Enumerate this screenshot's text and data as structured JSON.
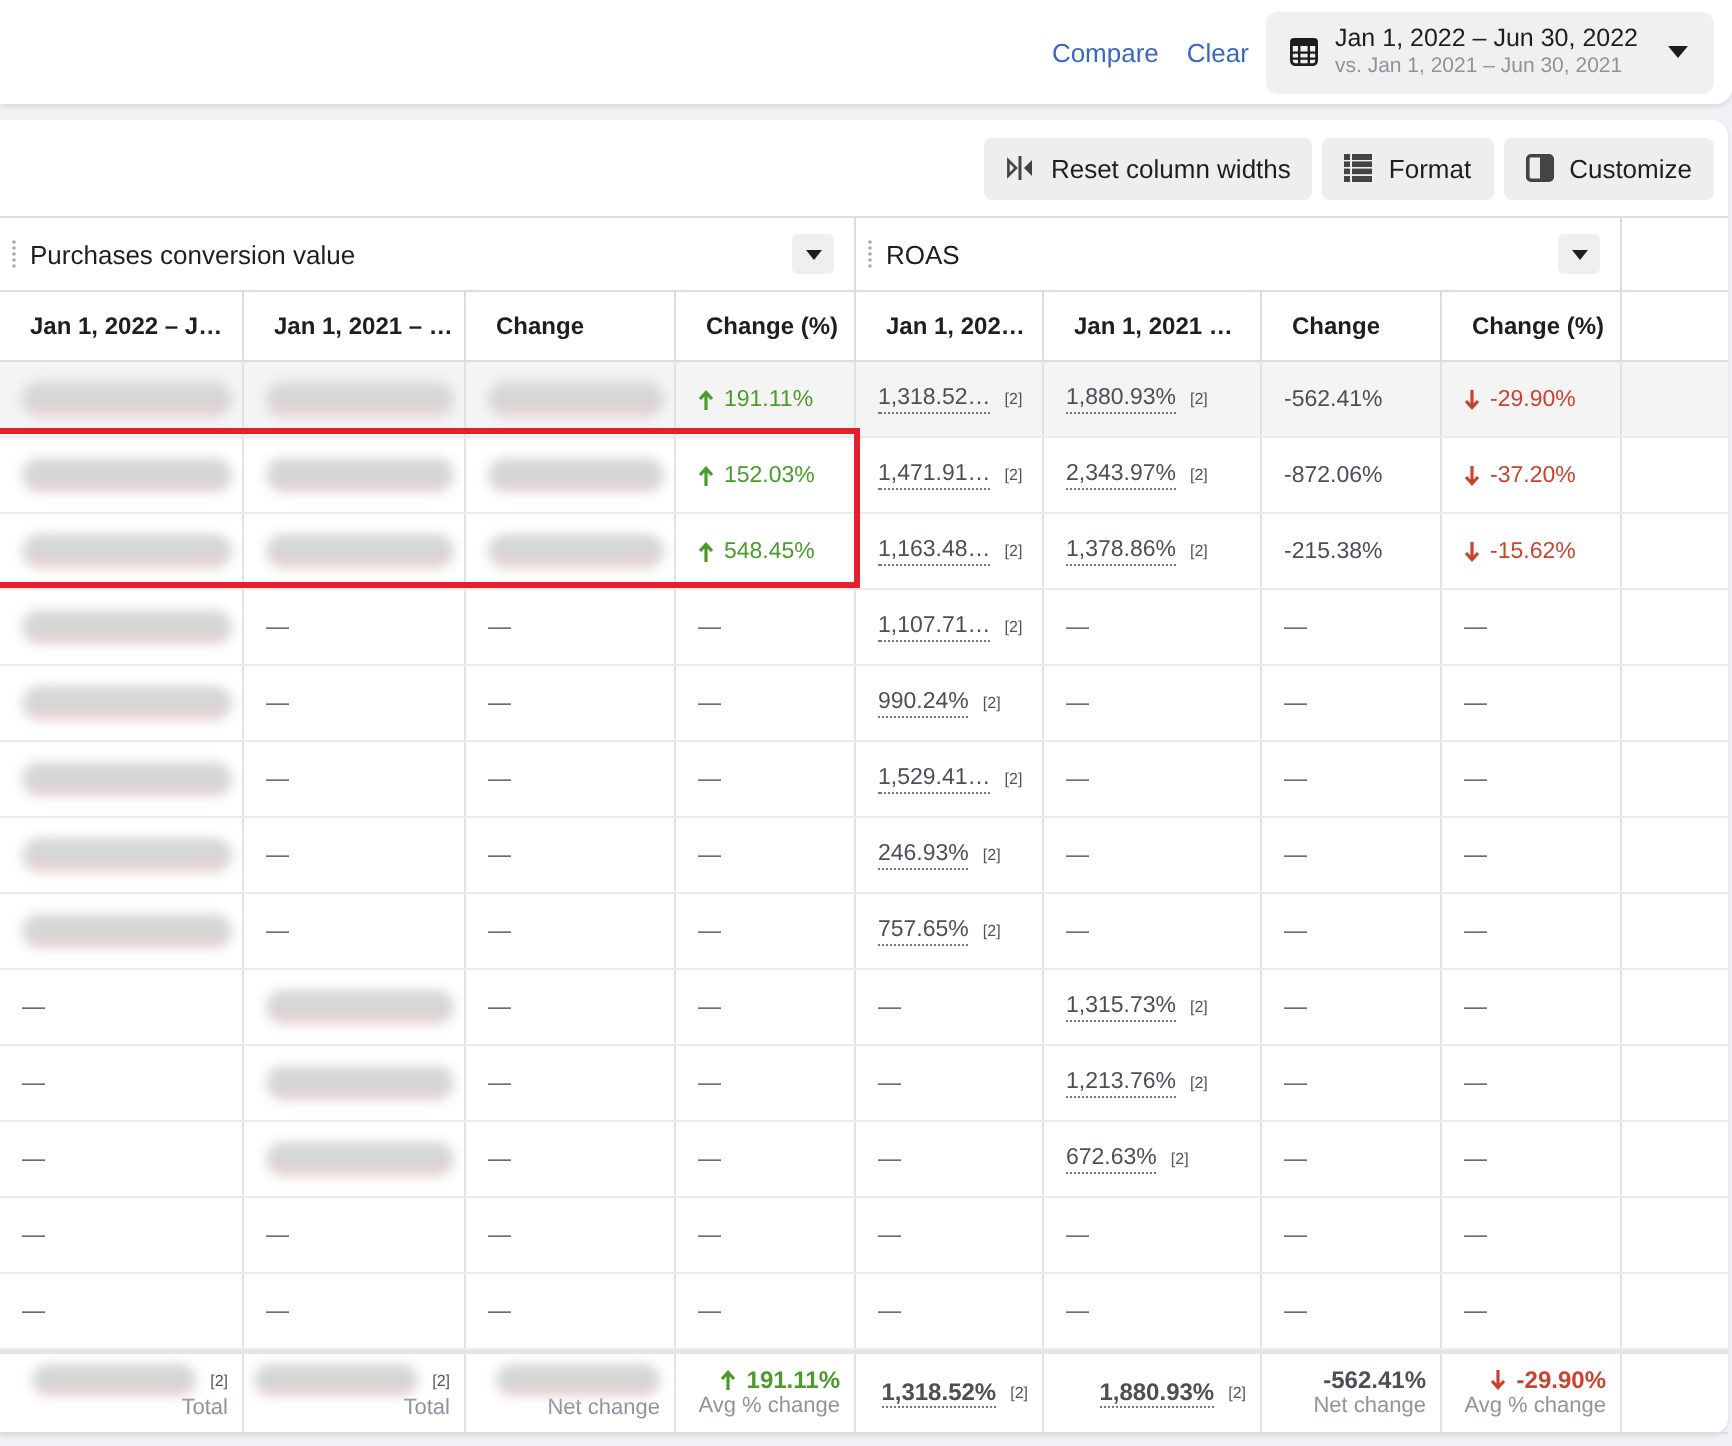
{
  "top_bar": {
    "links": [
      {
        "label": "Compare"
      },
      {
        "label": "Clear"
      }
    ],
    "date_range": {
      "range": "Jan 1, 2022 – Jun 30, 2022",
      "comparison": "vs. Jan 1, 2021 – Jun 30, 2021"
    }
  },
  "toolbar": {
    "buttons": [
      {
        "label": "Reset column widths"
      },
      {
        "label": "Format"
      },
      {
        "label": "Customize"
      }
    ]
  },
  "table": {
    "column_groups": [
      {
        "label": "Purchases conversion value"
      },
      {
        "label": "ROAS"
      }
    ],
    "columns": [
      "Jan 1, 2022 – J…",
      "Jan 1, 2021 – …",
      "Change",
      "Change (%)",
      "Jan 1, 202…",
      "Jan 1, 2021 …",
      "Change",
      "Change (%)"
    ],
    "rows": [
      {
        "hovered": true,
        "highlighted": false,
        "cells": [
          {
            "kind": "redacted"
          },
          {
            "kind": "redacted"
          },
          {
            "kind": "redacted"
          },
          {
            "kind": "increase",
            "text": "191.11%"
          },
          {
            "kind": "metric",
            "text": "1,318.52…",
            "badge": "[2]"
          },
          {
            "kind": "metric",
            "text": "1,880.93%",
            "badge": "[2]"
          },
          {
            "kind": "plain",
            "text": "-562.41%"
          },
          {
            "kind": "decrease",
            "text": "-29.90%"
          }
        ]
      },
      {
        "hovered": false,
        "highlighted": true,
        "cells": [
          {
            "kind": "redacted"
          },
          {
            "kind": "redacted"
          },
          {
            "kind": "redacted"
          },
          {
            "kind": "increase",
            "text": "152.03%"
          },
          {
            "kind": "metric",
            "text": "1,471.91…",
            "badge": "[2]"
          },
          {
            "kind": "metric",
            "text": "2,343.97%",
            "badge": "[2]"
          },
          {
            "kind": "plain",
            "text": "-872.06%"
          },
          {
            "kind": "decrease",
            "text": "-37.20%"
          }
        ]
      },
      {
        "hovered": false,
        "highlighted": true,
        "cells": [
          {
            "kind": "redacted"
          },
          {
            "kind": "redacted"
          },
          {
            "kind": "redacted"
          },
          {
            "kind": "increase",
            "text": "548.45%"
          },
          {
            "kind": "metric",
            "text": "1,163.48…",
            "badge": "[2]"
          },
          {
            "kind": "metric",
            "text": "1,378.86%",
            "badge": "[2]"
          },
          {
            "kind": "plain",
            "text": "-215.38%"
          },
          {
            "kind": "decrease",
            "text": "-15.62%"
          }
        ]
      },
      {
        "hovered": false,
        "highlighted": false,
        "cells": [
          {
            "kind": "redacted"
          },
          {
            "kind": "dash",
            "text": "—"
          },
          {
            "kind": "dash",
            "text": "—"
          },
          {
            "kind": "dash",
            "text": "—"
          },
          {
            "kind": "metric",
            "text": "1,107.71…",
            "badge": "[2]"
          },
          {
            "kind": "dash",
            "text": "—"
          },
          {
            "kind": "dash",
            "text": "—"
          },
          {
            "kind": "dash",
            "text": "—"
          }
        ]
      },
      {
        "hovered": false,
        "highlighted": false,
        "cells": [
          {
            "kind": "redacted"
          },
          {
            "kind": "dash",
            "text": "—"
          },
          {
            "kind": "dash",
            "text": "—"
          },
          {
            "kind": "dash",
            "text": "—"
          },
          {
            "kind": "metric",
            "text": "990.24%",
            "badge": "[2]"
          },
          {
            "kind": "dash",
            "text": "—"
          },
          {
            "kind": "dash",
            "text": "—"
          },
          {
            "kind": "dash",
            "text": "—"
          }
        ]
      },
      {
        "hovered": false,
        "highlighted": false,
        "cells": [
          {
            "kind": "redacted"
          },
          {
            "kind": "dash",
            "text": "—"
          },
          {
            "kind": "dash",
            "text": "—"
          },
          {
            "kind": "dash",
            "text": "—"
          },
          {
            "kind": "metric",
            "text": "1,529.41…",
            "badge": "[2]"
          },
          {
            "kind": "dash",
            "text": "—"
          },
          {
            "kind": "dash",
            "text": "—"
          },
          {
            "kind": "dash",
            "text": "—"
          }
        ]
      },
      {
        "hovered": false,
        "highlighted": false,
        "cells": [
          {
            "kind": "redacted"
          },
          {
            "kind": "dash",
            "text": "—"
          },
          {
            "kind": "dash",
            "text": "—"
          },
          {
            "kind": "dash",
            "text": "—"
          },
          {
            "kind": "metric",
            "text": "246.93%",
            "badge": "[2]"
          },
          {
            "kind": "dash",
            "text": "—"
          },
          {
            "kind": "dash",
            "text": "—"
          },
          {
            "kind": "dash",
            "text": "—"
          }
        ]
      },
      {
        "hovered": false,
        "highlighted": false,
        "cells": [
          {
            "kind": "redacted"
          },
          {
            "kind": "dash",
            "text": "—"
          },
          {
            "kind": "dash",
            "text": "—"
          },
          {
            "kind": "dash",
            "text": "—"
          },
          {
            "kind": "metric",
            "text": "757.65%",
            "badge": "[2]"
          },
          {
            "kind": "dash",
            "text": "—"
          },
          {
            "kind": "dash",
            "text": "—"
          },
          {
            "kind": "dash",
            "text": "—"
          }
        ]
      },
      {
        "hovered": false,
        "highlighted": false,
        "cells": [
          {
            "kind": "dash",
            "text": "—"
          },
          {
            "kind": "redacted"
          },
          {
            "kind": "dash",
            "text": "—"
          },
          {
            "kind": "dash",
            "text": "—"
          },
          {
            "kind": "dash",
            "text": "—"
          },
          {
            "kind": "metric",
            "text": "1,315.73%",
            "badge": "[2]"
          },
          {
            "kind": "dash",
            "text": "—"
          },
          {
            "kind": "dash",
            "text": "—"
          }
        ]
      },
      {
        "hovered": false,
        "highlighted": false,
        "cells": [
          {
            "kind": "dash",
            "text": "—"
          },
          {
            "kind": "redacted"
          },
          {
            "kind": "dash",
            "text": "—"
          },
          {
            "kind": "dash",
            "text": "—"
          },
          {
            "kind": "dash",
            "text": "—"
          },
          {
            "kind": "metric",
            "text": "1,213.76%",
            "badge": "[2]"
          },
          {
            "kind": "dash",
            "text": "—"
          },
          {
            "kind": "dash",
            "text": "—"
          }
        ]
      },
      {
        "hovered": false,
        "highlighted": false,
        "cells": [
          {
            "kind": "dash",
            "text": "—"
          },
          {
            "kind": "redacted"
          },
          {
            "kind": "dash",
            "text": "—"
          },
          {
            "kind": "dash",
            "text": "—"
          },
          {
            "kind": "dash",
            "text": "—"
          },
          {
            "kind": "metric",
            "text": "672.63%",
            "badge": "[2]"
          },
          {
            "kind": "dash",
            "text": "—"
          },
          {
            "kind": "dash",
            "text": "—"
          }
        ]
      },
      {
        "hovered": false,
        "highlighted": false,
        "cells": [
          {
            "kind": "dash",
            "text": "—"
          },
          {
            "kind": "dash",
            "text": "—"
          },
          {
            "kind": "dash",
            "text": "—"
          },
          {
            "kind": "dash",
            "text": "—"
          },
          {
            "kind": "dash",
            "text": "—"
          },
          {
            "kind": "dash",
            "text": "—"
          },
          {
            "kind": "dash",
            "text": "—"
          },
          {
            "kind": "dash",
            "text": "—"
          }
        ]
      },
      {
        "hovered": false,
        "highlighted": false,
        "cells": [
          {
            "kind": "dash",
            "text": "—"
          },
          {
            "kind": "dash",
            "text": "—"
          },
          {
            "kind": "dash",
            "text": "—"
          },
          {
            "kind": "dash",
            "text": "—"
          },
          {
            "kind": "dash",
            "text": "—"
          },
          {
            "kind": "dash",
            "text": "—"
          },
          {
            "kind": "dash",
            "text": "—"
          },
          {
            "kind": "dash",
            "text": "—"
          }
        ]
      }
    ],
    "totals": [
      {
        "kind": "redacted",
        "badge": "[2]",
        "caption": "Total"
      },
      {
        "kind": "redacted",
        "badge": "[2]",
        "caption": "Total"
      },
      {
        "kind": "redacted",
        "caption": "Net change"
      },
      {
        "kind": "increase",
        "text": "191.11%",
        "caption": "Avg % change"
      },
      {
        "kind": "metric",
        "text": "1,318.52%",
        "badge": "[2]"
      },
      {
        "kind": "metric",
        "text": "1,880.93%",
        "badge": "[2]"
      },
      {
        "kind": "plain",
        "text": "-562.41%",
        "caption": "Net change"
      },
      {
        "kind": "decrease",
        "text": "-29.90%",
        "caption": "Avg % change"
      }
    ]
  }
}
